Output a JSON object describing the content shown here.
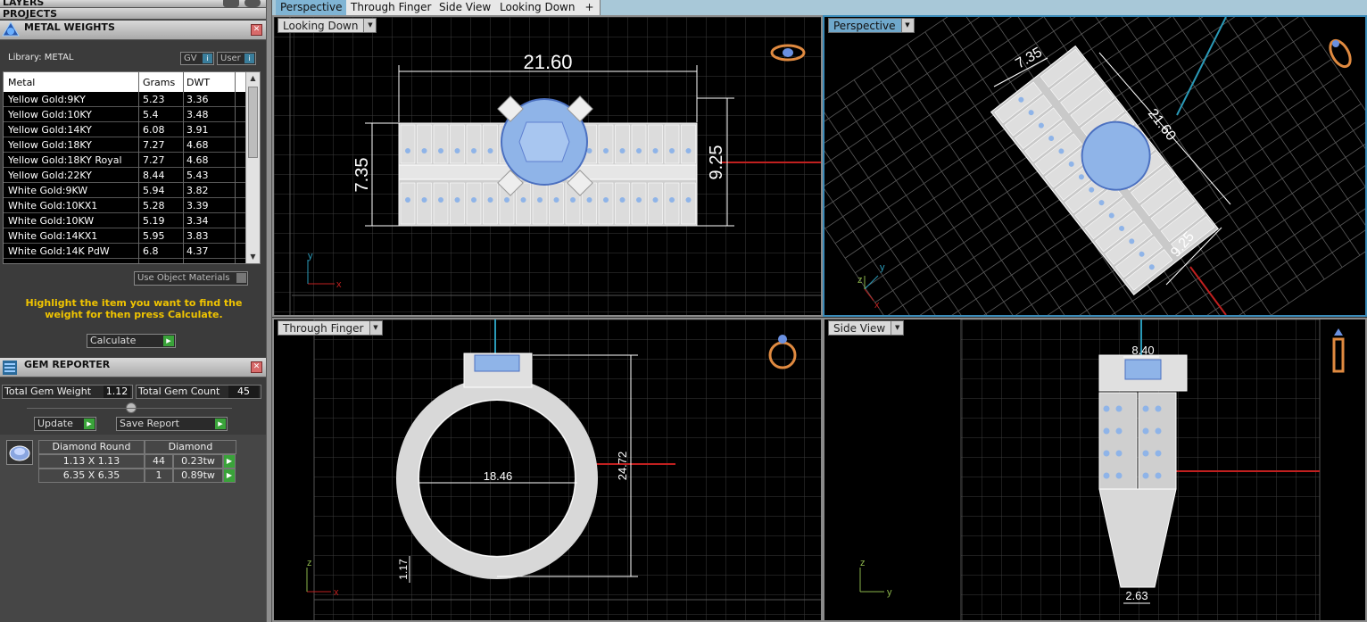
{
  "panels": {
    "layers_title": "LAYERS",
    "projects_title": "PROJECTS"
  },
  "metal_weights": {
    "title": "METAL WEIGHTS",
    "library_label": "Library: METAL",
    "toggle_gv": "GV",
    "toggle_user": "User",
    "columns": [
      "Metal",
      "Grams",
      "DWT"
    ],
    "rows": [
      {
        "metal": "Yellow Gold:9KY",
        "grams": "5.23",
        "dwt": "3.36"
      },
      {
        "metal": "Yellow Gold:10KY",
        "grams": "5.4",
        "dwt": "3.48"
      },
      {
        "metal": "Yellow Gold:14KY",
        "grams": "6.08",
        "dwt": "3.91"
      },
      {
        "metal": "Yellow Gold:18KY",
        "grams": "7.27",
        "dwt": "4.68"
      },
      {
        "metal": "Yellow Gold:18KY Royal",
        "grams": "7.27",
        "dwt": "4.68"
      },
      {
        "metal": "Yellow Gold:22KY",
        "grams": "8.44",
        "dwt": "5.43"
      },
      {
        "metal": "White Gold:9KW",
        "grams": "5.94",
        "dwt": "3.82"
      },
      {
        "metal": "White Gold:10KX1",
        "grams": "5.28",
        "dwt": "3.39"
      },
      {
        "metal": "White Gold:10KW",
        "grams": "5.19",
        "dwt": "3.34"
      },
      {
        "metal": "White Gold:14KX1",
        "grams": "5.95",
        "dwt": "3.83"
      },
      {
        "metal": "White Gold:14K PdW",
        "grams": "6.8",
        "dwt": "4.37"
      }
    ],
    "use_object_materials": "Use Object Materials",
    "instruction": "Highlight the item you want to find the weight for then press Calculate.",
    "calculate": "Calculate"
  },
  "gem_reporter": {
    "title": "GEM REPORTER",
    "total_weight_label": "Total Gem Weight",
    "total_weight_value": "1.12",
    "total_count_label": "Total Gem Count",
    "total_count_value": "45",
    "update": "Update",
    "save_report": "Save Report",
    "gem_headers": [
      "Diamond Round",
      "Diamond"
    ],
    "gems": [
      {
        "size": "1.13 X 1.13",
        "count": "44",
        "weight": "0.23tw"
      },
      {
        "size": "6.35 X 6.35",
        "count": "1",
        "weight": "0.89tw"
      }
    ]
  },
  "tabs": [
    "Perspective",
    "Through Finger",
    "Side View",
    "Looking Down",
    "+"
  ],
  "viewports": {
    "looking_down": {
      "label": "Looking Down",
      "dim_width": "21.60",
      "dim_left": "7.35",
      "dim_right": "9.25"
    },
    "perspective": {
      "label": "Perspective",
      "dim_a": "7.35",
      "dim_b": "21.60",
      "dim_c": "9.25"
    },
    "through_finger": {
      "label": "Through Finger",
      "dim_inner": "18.46",
      "dim_height": "24.72",
      "dim_shank": "1.17"
    },
    "side_view": {
      "label": "Side View",
      "dim_top": "8.40",
      "dim_bottom": "2.63"
    }
  },
  "axes": {
    "x": "x",
    "y": "y",
    "z": "z"
  },
  "colors": {
    "gem_blue": "#8fb4e8",
    "axis_red": "#c0201f",
    "axis_cyan": "#2a9ab8",
    "grid": "#3c3c3c",
    "wire": "#d8d8d8"
  }
}
